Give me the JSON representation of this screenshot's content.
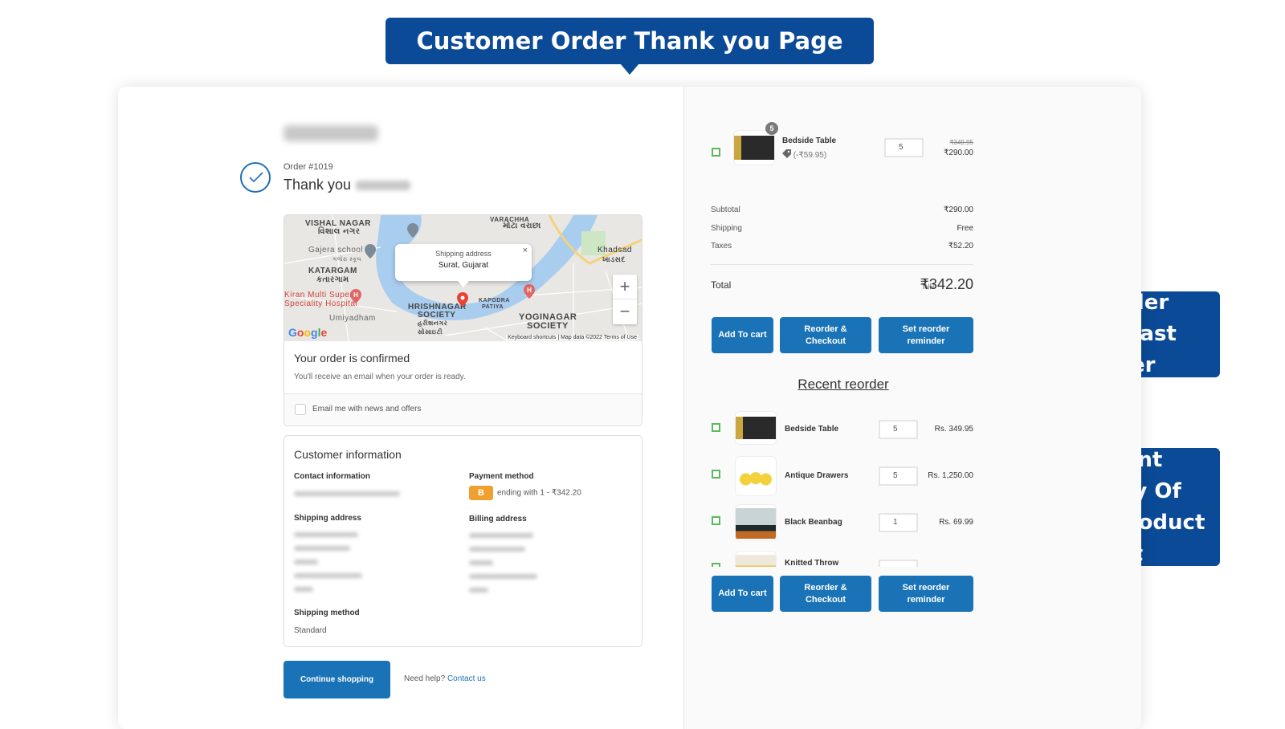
{
  "annotations": {
    "top_title": "Customer Order Thank you Page",
    "reorder_last": "Reorder Your Last Order",
    "recent_history": "Recent History Of Order Product List"
  },
  "header": {
    "order_number": "Order #1019",
    "thank_you": "Thank you"
  },
  "map": {
    "popup_title": "Shipping address",
    "popup_address": "Surat, Gujarat",
    "popup_close": "×",
    "zoom_in": "+",
    "zoom_out": "−",
    "google_logo": "Google",
    "footer": "Keyboard shortcuts | Map data ©2022   Terms of Use",
    "labels": {
      "vishal_nagar": "VISHAL NAGAR",
      "vishal_nagar_gu": "વિશાલ નગર",
      "varachha": "VARACHHA",
      "mota_varachha_gu": "મોટા વરાછા",
      "gajera_school": "Gajera school",
      "gajera_school_gu": "ગજેરા સ્કૂલ",
      "katargam": "KATARGAM",
      "katargam_gu": "કતારગામ",
      "kiran_hospital_1": "Kiran Multi Super",
      "kiran_hospital_2": "Speciality Hospital",
      "umiyadham": "Umiyadham",
      "hrishnagar_1": "HRISHNAGAR",
      "hrishnagar_2": "SOCIETY",
      "hrishnagar_gu": "હરીશનગર સોસાઇટી",
      "kapodra_1": "KAPODRA",
      "kapodra_2": "PATIYA",
      "khadsad": "Khadsad",
      "khadsad_gu": "ખાડસદ",
      "yoginagar_1": "YOGINAGAR",
      "yoginagar_2": "SOCIETY"
    }
  },
  "confirmation": {
    "title": "Your order is confirmed",
    "subtitle": "You'll receive an email when your order is ready.",
    "newsletter_label": "Email me with news and offers",
    "newsletter_checked": false
  },
  "customer_info": {
    "title": "Customer information",
    "contact_label": "Contact information",
    "payment_label": "Payment method",
    "payment_badge": "B",
    "payment_text": "ending with 1 - ₹342.20",
    "shipping_address_label": "Shipping address",
    "billing_address_label": "Billing address",
    "shipping_method_label": "Shipping method",
    "shipping_method_value": "Standard"
  },
  "footer": {
    "continue_button": "Continue shopping",
    "help_text": "Need help?",
    "contact_link": "Contact us"
  },
  "order_summary": {
    "item": {
      "name": "Bedside Table",
      "quantity_badge": "5",
      "discount": "(-₹59.95)",
      "quantity": "5",
      "original_price": "₹349.95",
      "price": "₹290.00"
    },
    "subtotal_label": "Subtotal",
    "subtotal_value": "₹290.00",
    "shipping_label": "Shipping",
    "shipping_value": "Free",
    "taxes_label": "Taxes",
    "taxes_value": "₹52.20",
    "total_label": "Total",
    "total_currency": "INR",
    "total_value": "₹342.20"
  },
  "actions": {
    "add_to_cart": "Add To cart",
    "reorder_checkout": "Reorder & Checkout",
    "set_reminder": "Set reorder reminder"
  },
  "recent_reorder": {
    "title": "Recent reorder",
    "items": [
      {
        "name": "Bedside Table",
        "quantity": "5",
        "price": "Rs. 349.95"
      },
      {
        "name": "Antique Drawers",
        "quantity": "5",
        "price": "Rs. 1,250.00"
      },
      {
        "name": "Black Beanbag",
        "quantity": "1",
        "price": "Rs. 69.99"
      },
      {
        "name": "Knitted Throw",
        "quantity": "",
        "price": ""
      }
    ]
  },
  "colors": {
    "annotation_blue": "#0b4a96",
    "button_blue": "#1a73b6",
    "checkbox_green": "#5cb85c",
    "payment_badge": "#f0a030"
  }
}
